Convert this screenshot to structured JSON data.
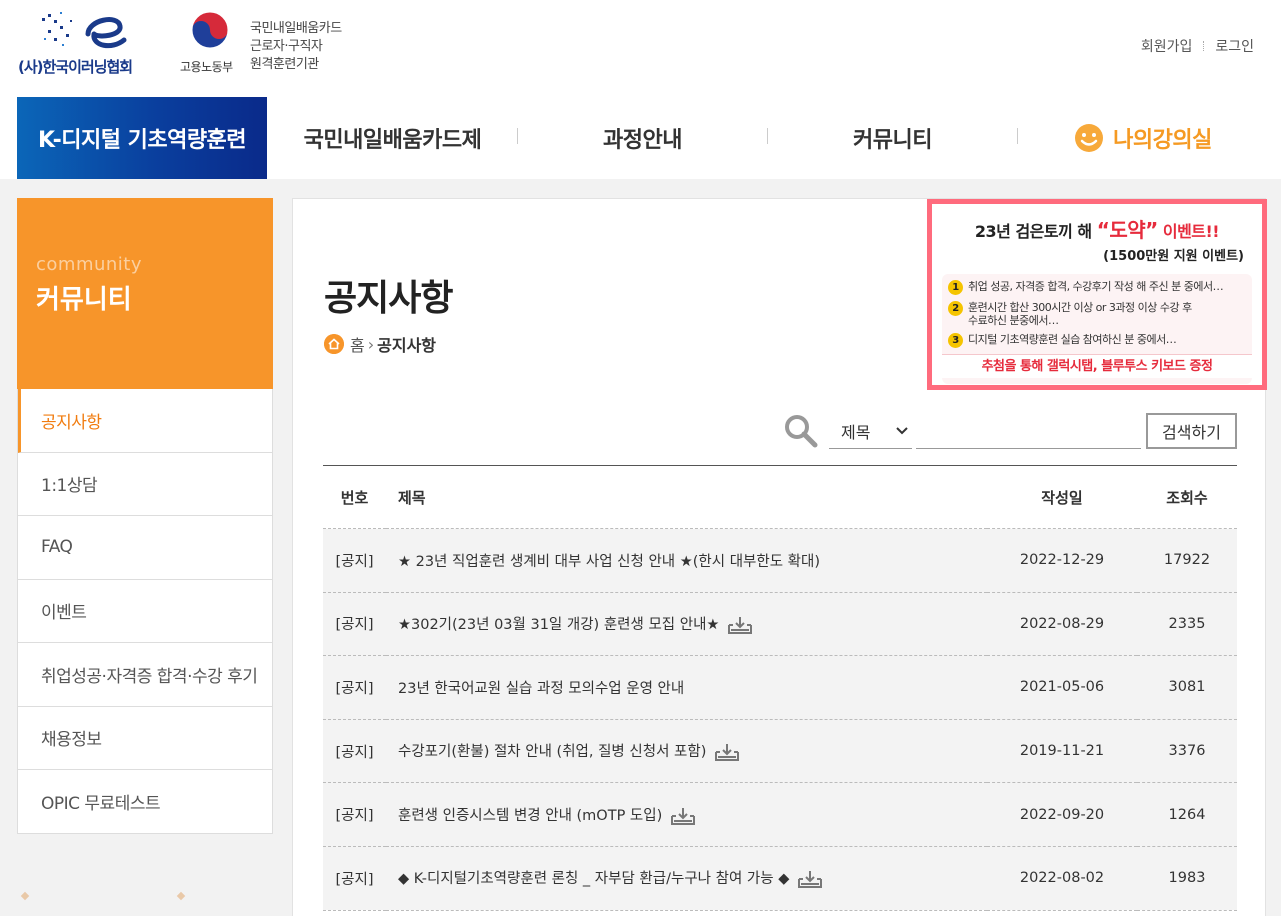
{
  "header": {
    "org_name": "(사)한국이러닝협회",
    "ministry": "고용노동부",
    "badge_lines": [
      "국민내일배움카드",
      "근로자·구직자",
      "원격훈련기관"
    ],
    "signup": "회원가입",
    "login": "로그인"
  },
  "gnb": {
    "banner": "K-디지털 기초역량훈련",
    "items": [
      "국민내일배움카드제",
      "과정안내",
      "커뮤니티",
      "나의강의실"
    ]
  },
  "sidebar": {
    "en": "community",
    "ko": "커뮤니티",
    "items": [
      "공지사항",
      "1:1상담",
      "FAQ",
      "이벤트",
      "취업성공·자격증 합격·수강 후기",
      "채용정보",
      "OPIC 무료테스트"
    ]
  },
  "content": {
    "title": "공지사항",
    "breadcrumb": {
      "home": "홈",
      "current": "공지사항"
    }
  },
  "event": {
    "title_pre": "23년 검은토끼 해 ",
    "title_em": "“도약”",
    "title_post": " 이벤트!!",
    "subtitle": "(1500만원 지원 이벤트)",
    "items": [
      "취업 성공, 자격증 합격, 수강후기 작성 해 주신 분 중에서…",
      "훈련시간 합산 300시간 이상 or 3과정 이상 수강 후",
      "수료하신 분중에서…",
      "디지털 기초역량훈련 실습 참여하신 분 중에서…"
    ],
    "prize": "추첨을 통해 갤럭시탭, 블루투스 키보드 증정"
  },
  "search": {
    "select_value": "제목",
    "button": "검색하기"
  },
  "table": {
    "headers": {
      "no": "번호",
      "title": "제목",
      "date": "작성일",
      "views": "조회수"
    },
    "rows": [
      {
        "no": "[공지]",
        "title": "★ 23년 직업훈련 생계비 대부 사업 신청 안내 ★(한시 대부한도 확대)",
        "date": "2022-12-29",
        "views": "17922",
        "attach": false
      },
      {
        "no": "[공지]",
        "title": "★302기(23년 03월 31일 개강) 훈련생 모집 안내★",
        "date": "2022-08-29",
        "views": "2335",
        "attach": true
      },
      {
        "no": "[공지]",
        "title": "23년 한국어교원 실습 과정 모의수업 운영 안내",
        "date": "2021-05-06",
        "views": "3081",
        "attach": false
      },
      {
        "no": "[공지]",
        "title": "수강포기(환불) 절차 안내 (취업, 질병 신청서 포함)",
        "date": "2019-11-21",
        "views": "3376",
        "attach": true
      },
      {
        "no": "[공지]",
        "title": "훈련생 인증시스템 변경 안내 (mOTP 도입)",
        "date": "2022-09-20",
        "views": "1264",
        "attach": true
      },
      {
        "no": "[공지]",
        "title": "◆ K-디지털기초역량훈련 론칭 _ 자부담 환급/누구나 참여 가능 ◆",
        "date": "2022-08-02",
        "views": "1983",
        "attach": true
      }
    ]
  },
  "colors": {
    "accent": "#f7952a",
    "brand_blue": "#0a3f9e",
    "event_pink": "#ff6b7d"
  }
}
